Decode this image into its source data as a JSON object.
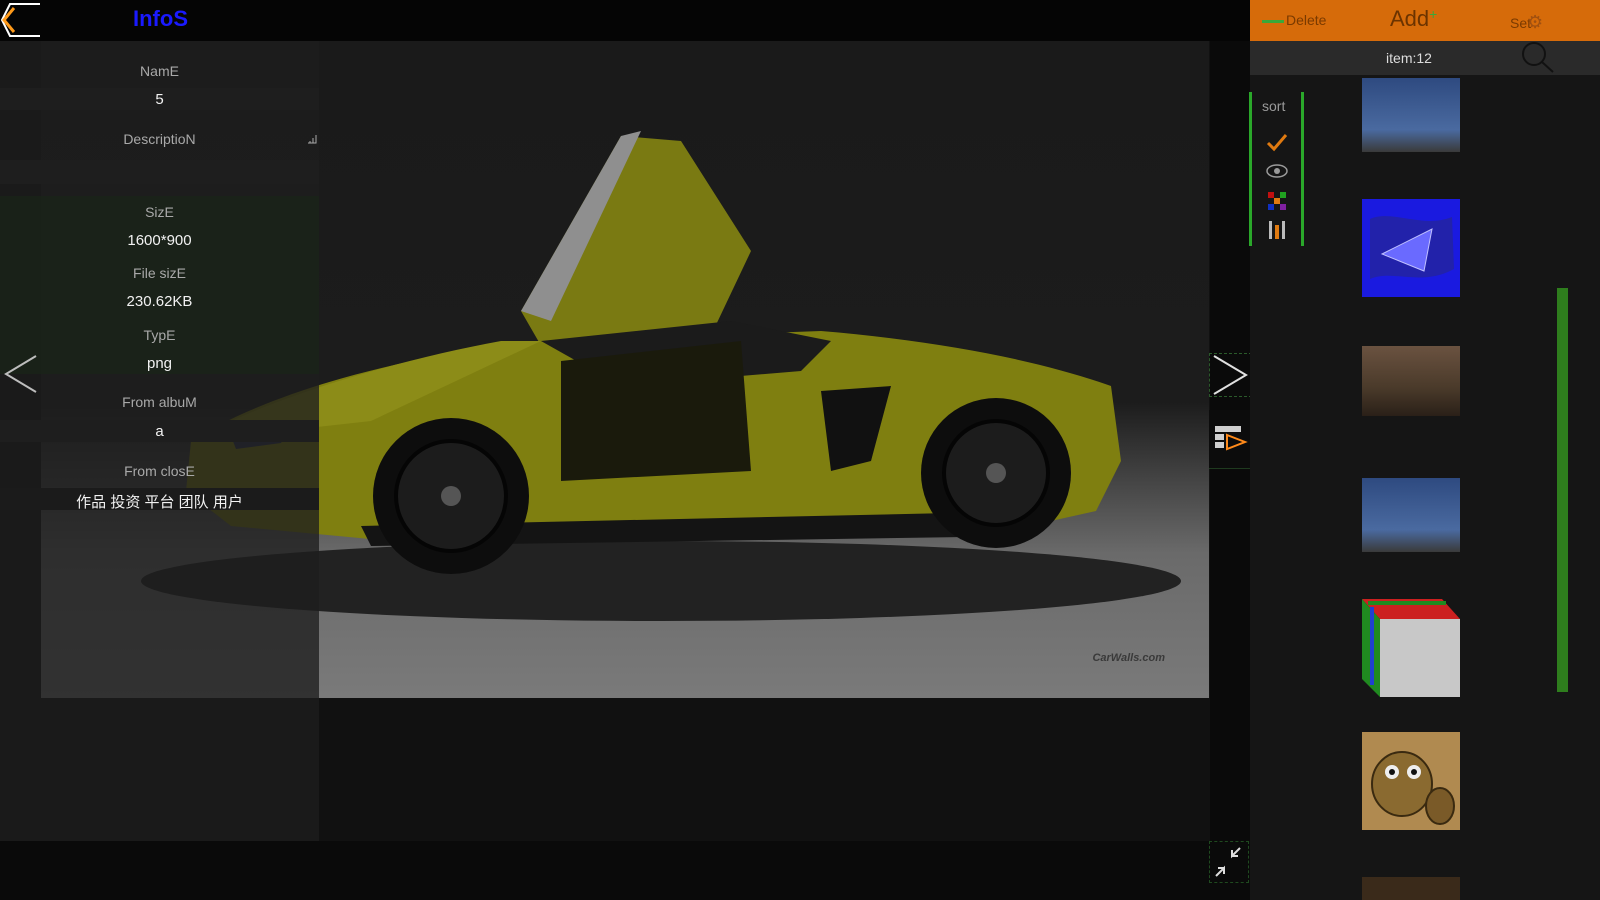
{
  "header": {
    "title": "InfoS"
  },
  "info": {
    "name_label": "NamE",
    "name_value": "5",
    "description_label": "DescriptioN",
    "description_value": "",
    "size_label": "SizE",
    "size_value": "1600*900",
    "file_size_label": "File sizE",
    "file_size_value": "230.62KB",
    "type_label": "TypE",
    "type_value": "png",
    "album_label": "From albuM",
    "album_value": "a",
    "close_label": "From closE",
    "close_value": "作品 投资 平台 团队 用户"
  },
  "photo": {
    "watermark": "CarWalls.com",
    "car_color": "#8a8a10"
  },
  "right_panel": {
    "delete_label": "Delete",
    "add_label": "Add",
    "settings_label": "Set",
    "item_count": "item:12",
    "sort_label": "sort",
    "accent": "#d66b0a",
    "scroll_color": "#2e7d1d"
  },
  "thumbnails": [
    {
      "name": "sky-landscape"
    },
    {
      "name": "blue-paint"
    },
    {
      "name": "rock-texture"
    },
    {
      "name": "sky-landscape-2"
    },
    {
      "name": "color-cube"
    },
    {
      "name": "cartoon-robot"
    }
  ]
}
